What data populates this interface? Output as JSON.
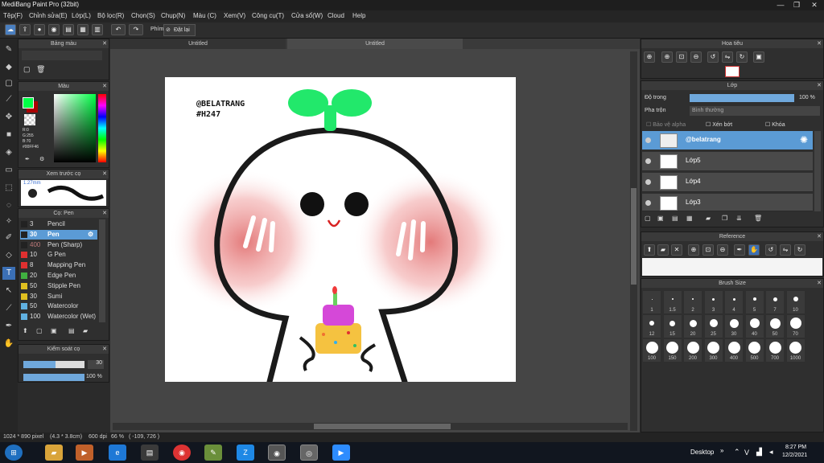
{
  "window": {
    "title": "MediBang Paint Pro (32bit)",
    "min": "—",
    "max": "❐",
    "close": "✕"
  },
  "menu": [
    "Tệp(F)",
    "Chỉnh sửa(E)",
    "Lớp(L)",
    "Bộ lọc(R)",
    "Chọn(S)",
    "Chụp(N)",
    "Màu (C)",
    "Xem(V)",
    "Công cụ(T)",
    "Cửa sổ(W)",
    "Cloud",
    "Help"
  ],
  "toolbar": {
    "phim_label": "Phím",
    "reset_label": "Đặt lại"
  },
  "panels": {
    "palette": {
      "title": "Bảng màu"
    },
    "color": {
      "title": "Màu",
      "r": "R:0",
      "g": "G:255",
      "b": "B:70",
      "hex": "#00FF46",
      "fg": "#00ff46",
      "bg": "#ffffff"
    },
    "preview": {
      "title": "Xem trước cọ",
      "size": "1.27mm"
    },
    "brush": {
      "title": "Cọ: Pen",
      "items": [
        {
          "size": "3",
          "name": "Pencil",
          "color": "#222222"
        },
        {
          "size": "30",
          "name": "Pen",
          "color": "#222222"
        },
        {
          "size": "400",
          "name": "Pen (Sharp)",
          "color": "#222222"
        },
        {
          "size": "10",
          "name": "G Pen",
          "color": "#e03030"
        },
        {
          "size": "8",
          "name": "Mapping Pen",
          "color": "#e03030"
        },
        {
          "size": "20",
          "name": "Edge Pen",
          "color": "#40b040"
        },
        {
          "size": "50",
          "name": "Stipple Pen",
          "color": "#e0c020"
        },
        {
          "size": "30",
          "name": "Sumi",
          "color": "#e0c020"
        },
        {
          "size": "50",
          "name": "Watercolor",
          "color": "#60b0e0"
        },
        {
          "size": "100",
          "name": "Watercolor (Wet)",
          "color": "#60b0e0"
        }
      ]
    },
    "brushcontrol": {
      "title": "Kiểm soát cọ",
      "size": "30",
      "opacity": "100 %"
    },
    "navigator": {
      "title": "Hoa tiêu"
    },
    "layer": {
      "title": "Lớp",
      "opacity_label": "Độ trong",
      "opacity_value": "100 %",
      "blend_label": "Pha trộn",
      "blend_value": "Bình thường",
      "protect_alpha": "Bảo vệ alpha",
      "clipping": "Xén bớt",
      "lock": "Khóa",
      "layers": [
        "@belatrang",
        "Lớp5",
        "Lớp4",
        "Lớp3"
      ]
    },
    "reference": {
      "title": "Reference"
    },
    "brushsize": {
      "title": "Brush Size",
      "sizes": [
        "1",
        "1.5",
        "2",
        "3",
        "4",
        "5",
        "7",
        "10",
        "12",
        "15",
        "20",
        "25",
        "30",
        "40",
        "50",
        "70",
        "100",
        "150",
        "200",
        "300",
        "400",
        "500",
        "700",
        "1000"
      ]
    }
  },
  "tabs": [
    "Untitled",
    "Untitled"
  ],
  "canvas": {
    "text1": "@BELATRANG",
    "text2": "#H247"
  },
  "status": {
    "dims": "1024 * 890 pixel",
    "physical": "(4.3 * 3.8cm)",
    "dpi": "600 dpi",
    "zoom": "66 %",
    "coord": "( -109, 726 )"
  },
  "taskbar": {
    "desktop": "Desktop",
    "lang": "V",
    "time": "8:27 PM",
    "date": "12/2/2021"
  }
}
